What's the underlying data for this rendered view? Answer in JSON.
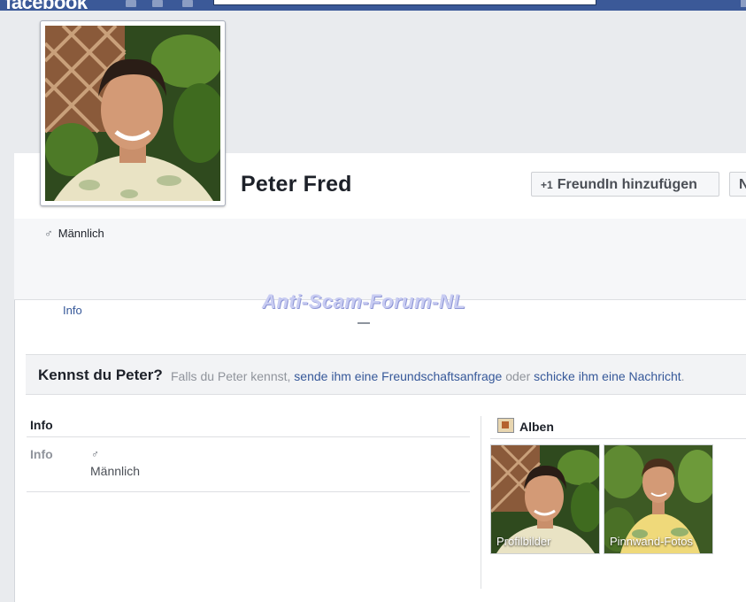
{
  "topbar": {
    "logo": "facebook"
  },
  "profile": {
    "name": "Peter Fred",
    "gender": "Männlich"
  },
  "actions": {
    "add_friend": "FreundIn hinzufügen",
    "more_partial": "N"
  },
  "tabs": {
    "info": "Info"
  },
  "watermark": "Anti-Scam-Forum-NL",
  "know_banner": {
    "title": "Kennst du Peter?",
    "text_prefix": "Falls du Peter kennst,",
    "link_request": "sende ihm eine Freundschaftsanfrage",
    "text_or": "oder",
    "link_message": "schicke ihm eine Nachricht",
    "text_end": "."
  },
  "info_section": {
    "heading": "Info",
    "label": "Info",
    "value": "Männlich"
  },
  "albums": {
    "heading": "Alben",
    "items": [
      {
        "label": "Profilbilder"
      },
      {
        "label": "Pinnwand-Fotos"
      }
    ]
  },
  "colors": {
    "brand": "#3b5998",
    "link": "#365899",
    "page_bg": "#e9ebee"
  },
  "icons": {
    "male": "male-icon",
    "add_friend": "add-friend-icon",
    "albums": "photo-album-icon"
  }
}
